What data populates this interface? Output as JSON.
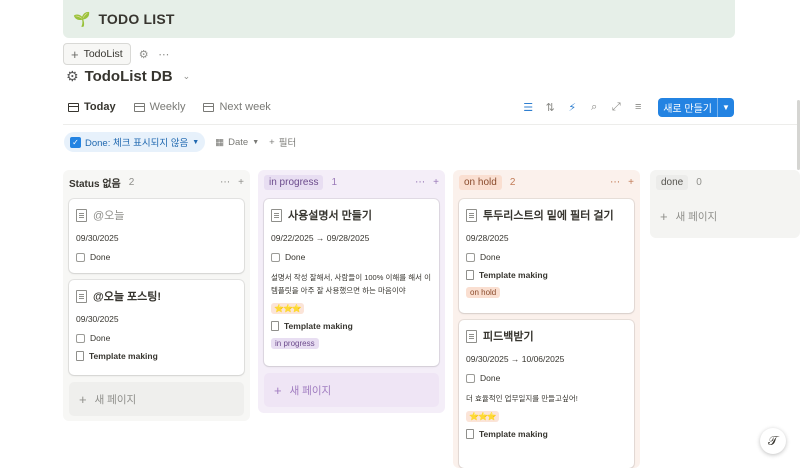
{
  "banner": {
    "icon": "sprout-icon",
    "title": "TODO LIST"
  },
  "db_tab": {
    "label": "TodoList"
  },
  "database": {
    "title": "TodoList DB"
  },
  "views": [
    {
      "label": "Today",
      "active": true
    },
    {
      "label": "Weekly",
      "active": false
    },
    {
      "label": "Next week",
      "active": false
    }
  ],
  "toolbar": {
    "new_label": "새로 만들기"
  },
  "filters": {
    "done_chip": "Done: 체크 표시되지 않음",
    "date": "Date",
    "add_filter": "필터"
  },
  "colors": {
    "accent": "#2383e2",
    "banner_bg": "#e6efe8",
    "inprogress_bg": "#f4eef8",
    "inprogress_tag": "#e8def2",
    "onhold_bg": "#fbf1ec",
    "onhold_tag": "#fadfd1",
    "done_tag": "#ececea",
    "nostatus_bg": "#f7f7f5"
  },
  "columns": [
    {
      "name": "Status 없음",
      "count": "2",
      "new_page": "새 페이지",
      "cards": [
        {
          "title": "@오늘",
          "date": "09/30/2025",
          "done": "Done"
        },
        {
          "title": "@오늘 포스팅!",
          "date": "09/30/2025",
          "done": "Done",
          "template": "Template making"
        }
      ]
    },
    {
      "name": "in progress",
      "count": "1",
      "new_page": "새 페이지",
      "cards": [
        {
          "title": "사용설명서 만들기",
          "date": "09/22/2025 → 09/28/2025",
          "done": "Done",
          "desc": "설명서 작성 잘해서, 사람들이 100% 이해를 해서 이 템플릿을 아주 잘 사용했으면 하는 마음이야",
          "stars": "⭐⭐⭐",
          "template": "Template making",
          "status": "in progress"
        }
      ]
    },
    {
      "name": "on hold",
      "count": "2",
      "cards": [
        {
          "title": "투두리스트의 밑에 필터 걸기",
          "date": "09/28/2025",
          "done": "Done",
          "template": "Template making",
          "status": "on hold"
        },
        {
          "title": "피드백받기",
          "date": "09/30/2025 → 10/06/2025",
          "done": "Done",
          "desc": "더 효율적인 업무일지를 만들고싶어!",
          "stars": "⭐⭐⭐",
          "template": "Template making"
        }
      ]
    },
    {
      "name": "done",
      "count": "0",
      "new_page": "새 페이지"
    }
  ],
  "help": {
    "glyph": "𝒯"
  }
}
